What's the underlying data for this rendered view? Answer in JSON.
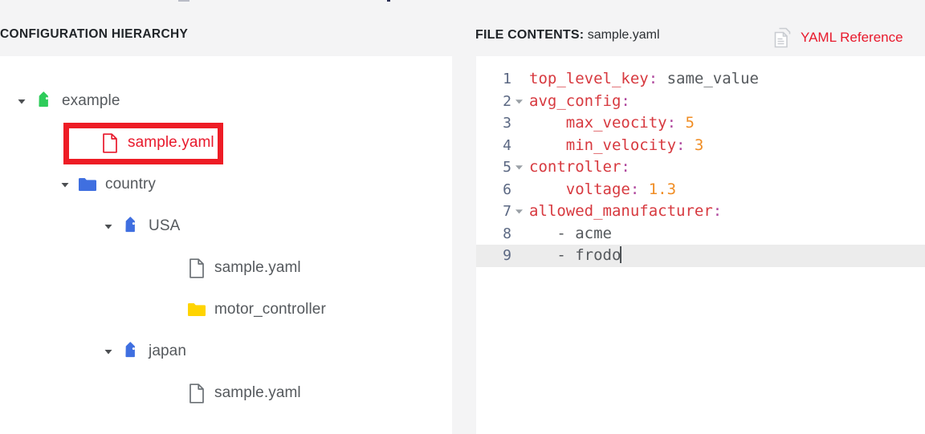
{
  "header": {
    "hierarchy_title": "CONFIGURATION HIERARCHY",
    "file_contents_label": "FILE CONTENTS:",
    "file_contents_name": "sample.yaml",
    "yaml_reference_label": "YAML Reference",
    "yaml_reference_icon": "documents-icon"
  },
  "colors": {
    "accent_red": "#e8192c",
    "annotation_red": "#ee1c25",
    "tag_green": "#2ecc5a",
    "tag_blue": "#3f6fe0",
    "folder_blue": "#3f6fe0",
    "folder_yellow": "#ffd400",
    "key_red": "#d7393f",
    "number_orange": "#f08d24",
    "colon_purple": "#b0499e",
    "active_line": "#ececec",
    "panel_gray": "#f4f4f5"
  },
  "tree": {
    "items": [
      {
        "label": "example",
        "icon": "tag-icon",
        "icon_color": "#2ecc5a",
        "twisty": "expanded",
        "indent": 18,
        "selected": false,
        "annotated": false
      },
      {
        "label": "sample.yaml",
        "icon": "file-icon",
        "icon_color": "#e8192c",
        "twisty": "none",
        "indent": 100,
        "selected": true,
        "annotated": true
      },
      {
        "label": "country",
        "icon": "folder-icon",
        "icon_color": "#3f6fe0",
        "twisty": "expanded",
        "indent": 72,
        "selected": false,
        "annotated": false
      },
      {
        "label": "USA",
        "icon": "tag-icon",
        "icon_color": "#3f6fe0",
        "twisty": "expanded",
        "indent": 126,
        "selected": false,
        "annotated": false
      },
      {
        "label": "sample.yaml",
        "icon": "file-icon",
        "icon_color": "#6b7075",
        "twisty": "none",
        "indent": 208,
        "selected": false,
        "annotated": false
      },
      {
        "label": "motor_controller",
        "icon": "folder-icon",
        "icon_color": "#ffd400",
        "twisty": "none",
        "indent": 208,
        "selected": false,
        "annotated": false
      },
      {
        "label": "japan",
        "icon": "tag-icon",
        "icon_color": "#3f6fe0",
        "twisty": "expanded",
        "indent": 126,
        "selected": false,
        "annotated": false
      },
      {
        "label": "sample.yaml",
        "icon": "file-icon",
        "icon_color": "#6b7075",
        "twisty": "none",
        "indent": 208,
        "selected": false,
        "annotated": false
      }
    ]
  },
  "editor": {
    "active_line": 9,
    "cursor_line": 9,
    "lines": [
      {
        "number": "1",
        "fold": false,
        "active": false,
        "tokens": [
          {
            "t": "top_level_key",
            "c": "key"
          },
          {
            "t": ":",
            "c": "colon"
          },
          {
            "t": " same_value",
            "c": "val"
          }
        ]
      },
      {
        "number": "2",
        "fold": true,
        "active": false,
        "tokens": [
          {
            "t": "avg_config",
            "c": "key"
          },
          {
            "t": ":",
            "c": "colon"
          }
        ]
      },
      {
        "number": "3",
        "fold": false,
        "active": false,
        "tokens": [
          {
            "t": "    max_veocity",
            "c": "key"
          },
          {
            "t": ":",
            "c": "colon"
          },
          {
            "t": " 5",
            "c": "num"
          }
        ]
      },
      {
        "number": "4",
        "fold": false,
        "active": false,
        "tokens": [
          {
            "t": "    min_velocity",
            "c": "key"
          },
          {
            "t": ":",
            "c": "colon"
          },
          {
            "t": " 3",
            "c": "num"
          }
        ]
      },
      {
        "number": "5",
        "fold": true,
        "active": false,
        "tokens": [
          {
            "t": "controller",
            "c": "key"
          },
          {
            "t": ":",
            "c": "colon"
          }
        ]
      },
      {
        "number": "6",
        "fold": false,
        "active": false,
        "tokens": [
          {
            "t": "    voltage",
            "c": "key"
          },
          {
            "t": ":",
            "c": "colon"
          },
          {
            "t": " 1.3",
            "c": "num"
          }
        ]
      },
      {
        "number": "7",
        "fold": true,
        "active": false,
        "tokens": [
          {
            "t": "allowed_manufacturer",
            "c": "key"
          },
          {
            "t": ":",
            "c": "colon"
          }
        ]
      },
      {
        "number": "8",
        "fold": false,
        "active": false,
        "tokens": [
          {
            "t": "   - ",
            "c": "dash"
          },
          {
            "t": "acme",
            "c": "val"
          }
        ]
      },
      {
        "number": "9",
        "fold": false,
        "active": true,
        "cursor": true,
        "tokens": [
          {
            "t": "   - ",
            "c": "dash"
          },
          {
            "t": "frodo",
            "c": "val"
          }
        ]
      }
    ]
  }
}
